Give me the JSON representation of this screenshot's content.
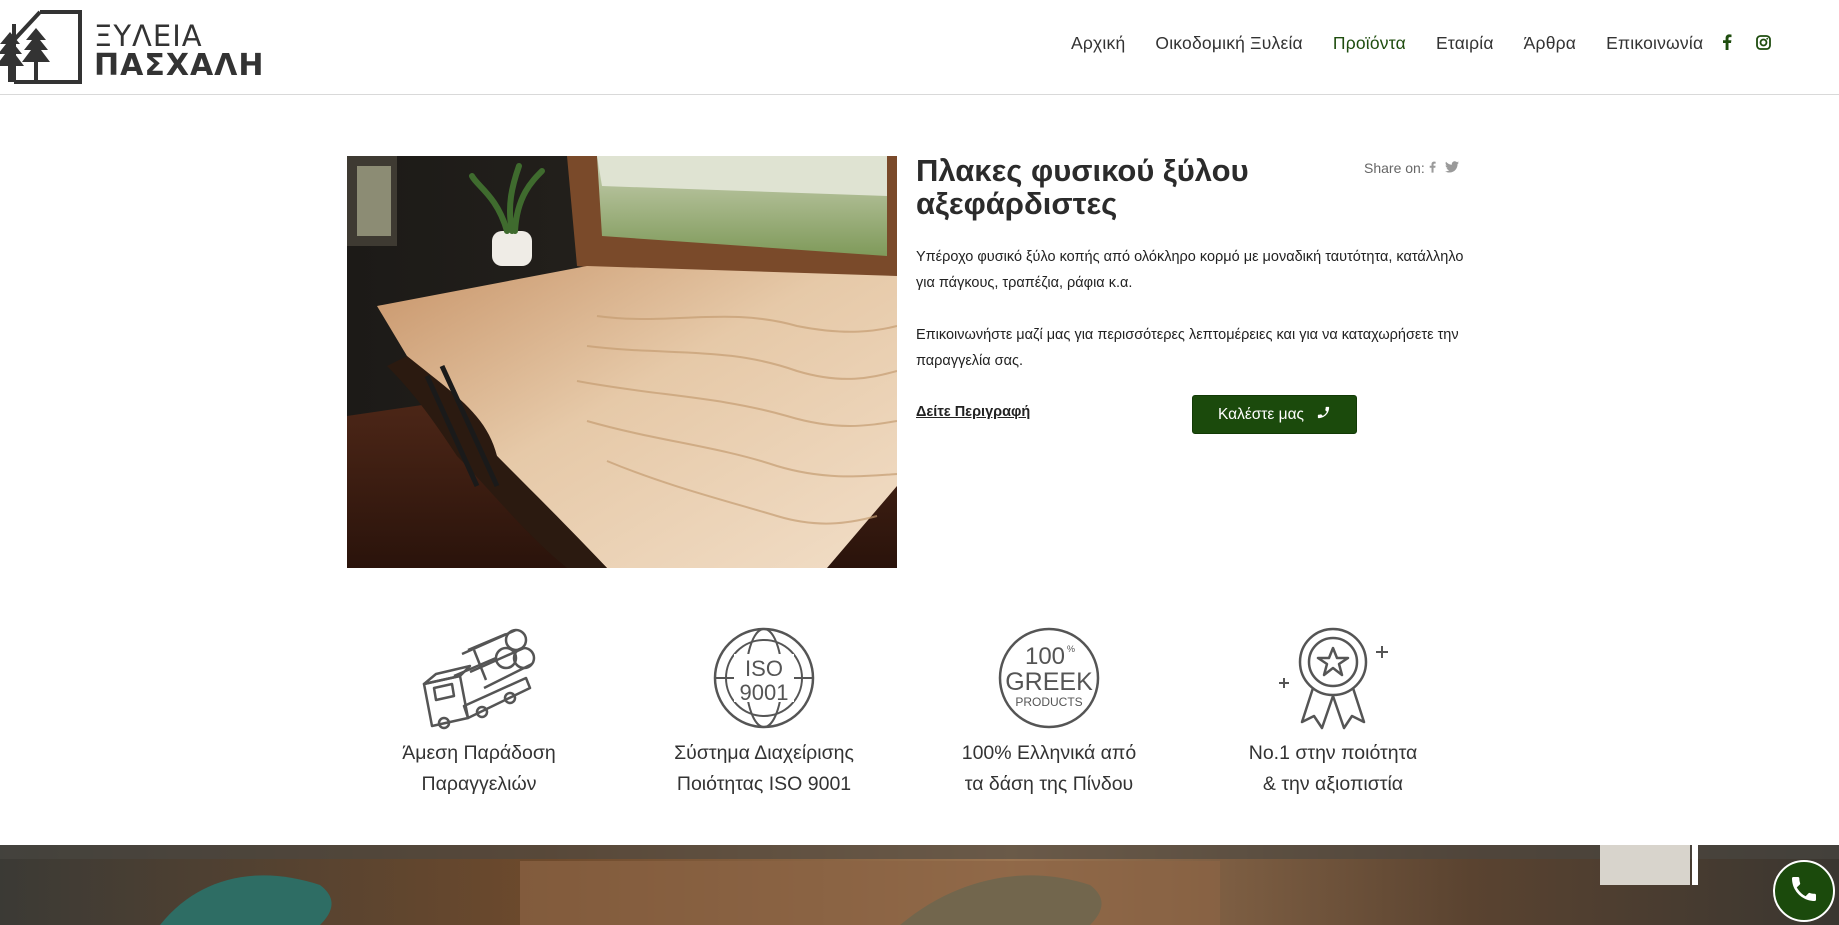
{
  "brand": {
    "line1": "ΞΥΛΕΙΑ",
    "line2": "ΠΑΣΧΑΛΗ"
  },
  "nav": {
    "items": [
      {
        "label": "Αρχική",
        "active": false
      },
      {
        "label": "Οικοδομική Ξυλεία",
        "active": false
      },
      {
        "label": "Προϊόντα",
        "active": true
      },
      {
        "label": "Εταιρία",
        "active": false
      },
      {
        "label": "Άρθρα",
        "active": false
      },
      {
        "label": "Επικοινωνία",
        "active": false
      }
    ],
    "social_icons": [
      "facebook-icon",
      "instagram-icon"
    ]
  },
  "product": {
    "title": "Πλακες φυσικού ξύλου αξεφάρδιστες",
    "share_label": "Share on:",
    "share_icons": [
      "facebook-icon",
      "twitter-icon"
    ],
    "description": [
      "Υπέροχο φυσικό ξύλο κοπής από ολόκληρο κορμό με μοναδική ταυτότητα, κατάλληλο για πάγκους, τραπέζια, ράφια κ.α.",
      "Επικοινωνήστε μαζί μας για περισσότερες λεπτομέρειες και για να καταχωρήσετε την παραγγελία σας."
    ],
    "see_description_label": "Δείτε Περιγραφή",
    "call_label": "Καλέστε μας"
  },
  "features": [
    {
      "icon": "truck-logs-icon",
      "line1": "Άμεση Παράδοση",
      "line2": "Παραγγελιών"
    },
    {
      "icon": "iso-9001-icon",
      "badge_line1": "ISO",
      "badge_line2": "9001",
      "line1": "Σύστημα Διαχείρισης",
      "line2": "Ποιότητας ISO 9001"
    },
    {
      "icon": "greek-products-icon",
      "badge_line1": "100",
      "badge_sup": "%",
      "badge_line2": "GREEK",
      "badge_line3": "PRODUCTS",
      "line1": "100% Ελληνικά από",
      "line2": "τα δάση της Πίνδου"
    },
    {
      "icon": "award-ribbon-icon",
      "line1": "No.1 στην ποιότητα",
      "line2": "& την αξιοπιστία"
    }
  ],
  "colors": {
    "brand_green": "#1b4a0c",
    "nav_active": "#1f4d0f",
    "text": "#333333"
  }
}
